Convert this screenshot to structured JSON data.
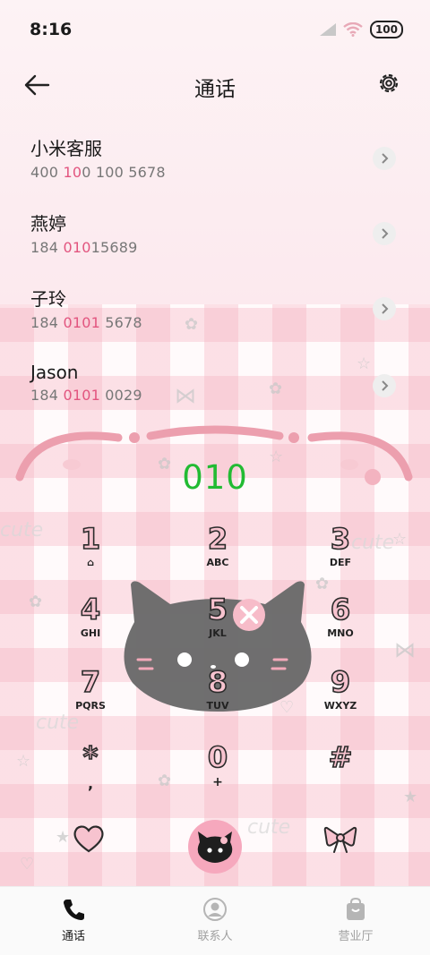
{
  "status_bar": {
    "time": "8:16",
    "battery": "100"
  },
  "header": {
    "title": "通话"
  },
  "calls": [
    {
      "name": "小米客服",
      "pre": "400 ",
      "hl": "10",
      "post": "0 100 5678"
    },
    {
      "name": "燕婷",
      "pre": "184 ",
      "hl": "010",
      "post": "15689"
    },
    {
      "name": "子玲",
      "pre": "184 ",
      "hl": "0101",
      "post": " 5678"
    },
    {
      "name": "Jason",
      "pre": "184 ",
      "hl": "0101",
      "post": " 0029"
    }
  ],
  "dial": {
    "input": "010"
  },
  "keypad": [
    {
      "digit": "1",
      "letters": ""
    },
    {
      "digit": "2",
      "letters": "ABC"
    },
    {
      "digit": "3",
      "letters": "DEF"
    },
    {
      "digit": "4",
      "letters": "GHI"
    },
    {
      "digit": "5",
      "letters": "JKL"
    },
    {
      "digit": "6",
      "letters": "MNO"
    },
    {
      "digit": "7",
      "letters": "PQRS"
    },
    {
      "digit": "8",
      "letters": "TUV"
    },
    {
      "digit": "9",
      "letters": "WXYZ"
    },
    {
      "digit": "*",
      "letters": ","
    },
    {
      "digit": "0",
      "letters": "+"
    },
    {
      "digit": "#",
      "letters": ""
    }
  ],
  "decor": {
    "cute_text": "cute"
  },
  "bottom_nav": [
    {
      "label": "通话",
      "icon": "phone-icon",
      "active": true
    },
    {
      "label": "联系人",
      "icon": "contact-icon",
      "active": false
    },
    {
      "label": "营业厅",
      "icon": "store-icon",
      "active": false
    }
  ],
  "colors": {
    "highlight": "#e2557f",
    "dial_text": "#22bb33",
    "call_button": "#f6a8bd"
  }
}
